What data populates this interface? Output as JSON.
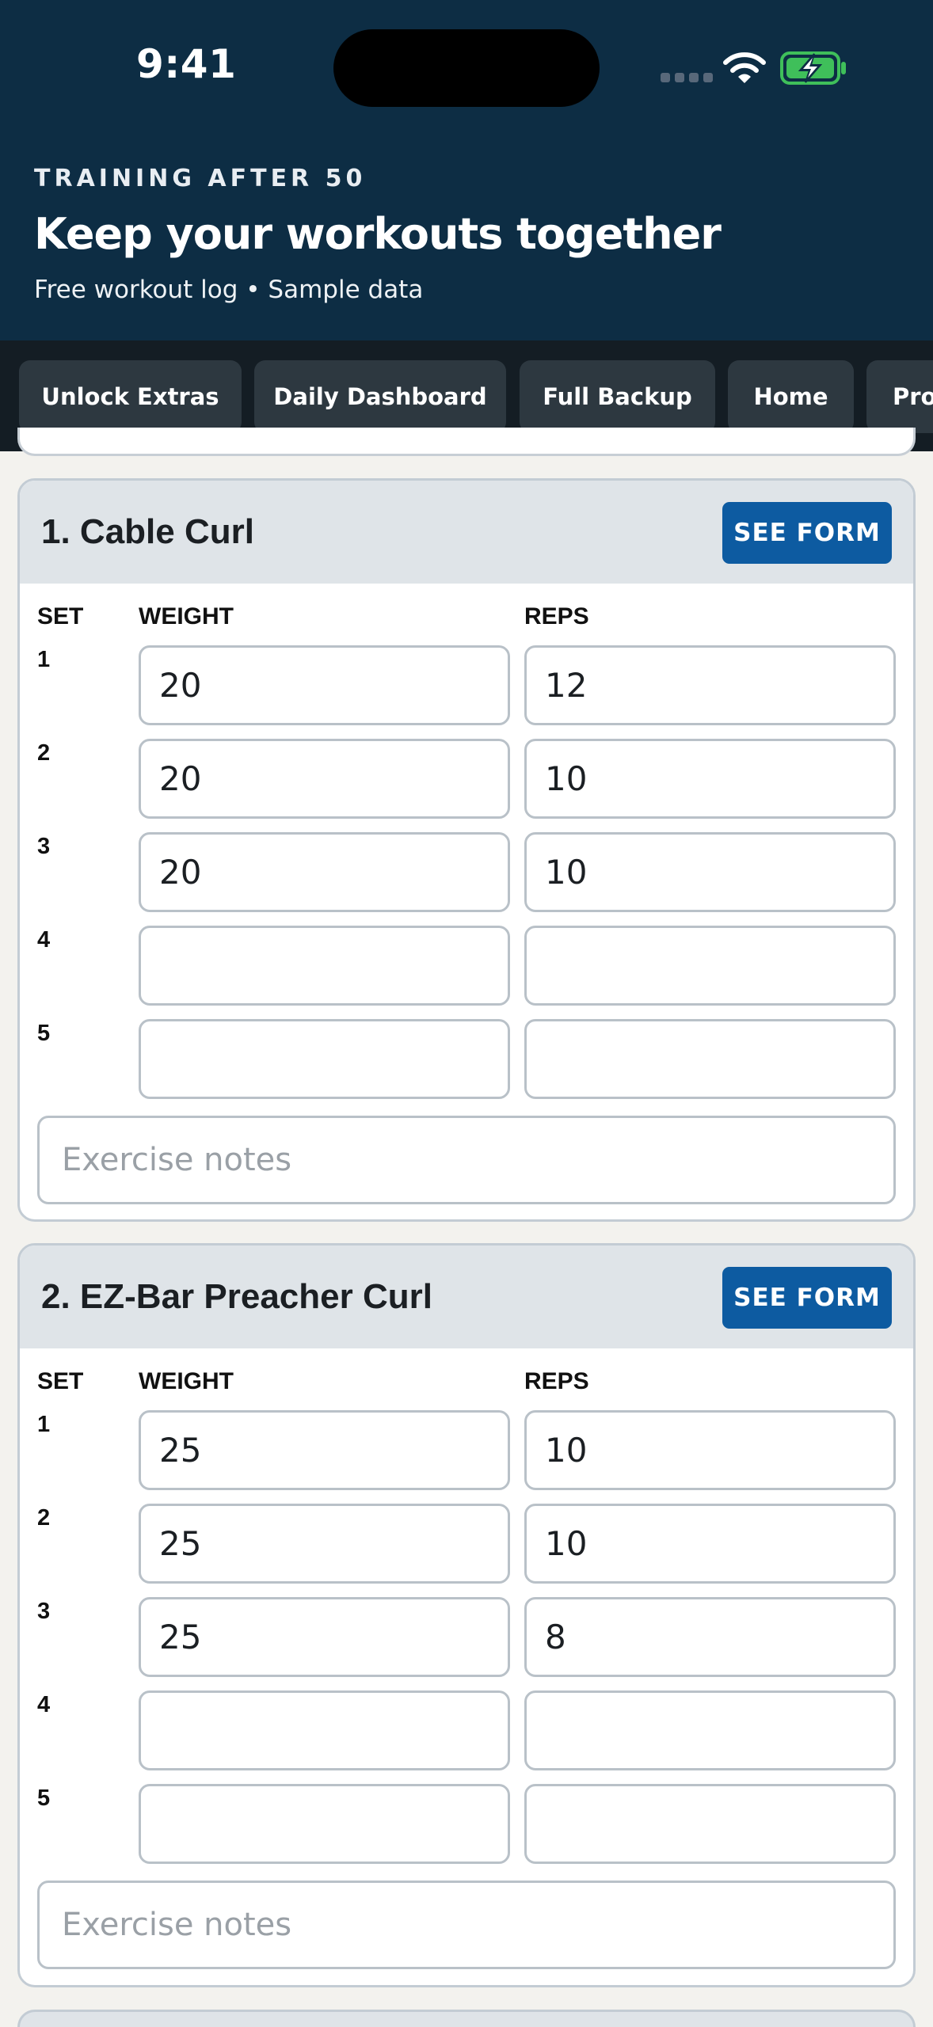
{
  "status_bar": {
    "time": "9:41"
  },
  "header": {
    "eyebrow": "TRAINING AFTER 50",
    "title": "Keep your workouts together",
    "subtitle": "Free workout log • Sample data"
  },
  "nav": {
    "items": [
      {
        "label": "Unlock Extras"
      },
      {
        "label": "Daily Dashboard"
      },
      {
        "label": "Full Backup"
      },
      {
        "label": "Home"
      },
      {
        "label": "Pro"
      }
    ]
  },
  "colors": {
    "header_bg": "#0d2d44",
    "nav_bg": "#141d24",
    "accent": "#0d5ba1",
    "card_head_bg": "#dfe4e8"
  },
  "columns": {
    "set": "SET",
    "weight": "WEIGHT",
    "reps": "REPS"
  },
  "exercises": [
    {
      "title": "1. Cable Curl",
      "see_form_label": "SEE FORM",
      "notes_placeholder": "Exercise notes",
      "sets": [
        {
          "set": "1",
          "weight": "20",
          "reps": "12"
        },
        {
          "set": "2",
          "weight": "20",
          "reps": "10"
        },
        {
          "set": "3",
          "weight": "20",
          "reps": "10"
        },
        {
          "set": "4",
          "weight": "",
          "reps": ""
        },
        {
          "set": "5",
          "weight": "",
          "reps": ""
        }
      ]
    },
    {
      "title": "2. EZ-Bar Preacher Curl",
      "see_form_label": "SEE FORM",
      "notes_placeholder": "Exercise notes",
      "sets": [
        {
          "set": "1",
          "weight": "25",
          "reps": "10"
        },
        {
          "set": "2",
          "weight": "25",
          "reps": "10"
        },
        {
          "set": "3",
          "weight": "25",
          "reps": "8"
        },
        {
          "set": "4",
          "weight": "",
          "reps": ""
        },
        {
          "set": "5",
          "weight": "",
          "reps": ""
        }
      ]
    }
  ]
}
